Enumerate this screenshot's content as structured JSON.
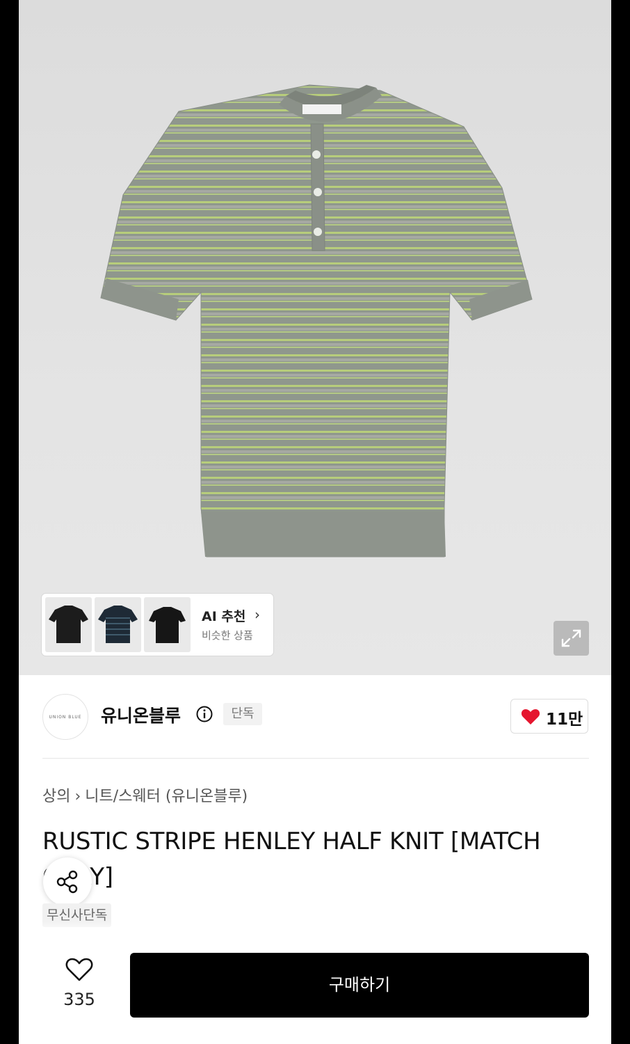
{
  "ai_recommend": {
    "title": "AI 추천",
    "subtitle": "비슷한 상품",
    "thumbnails": [
      "black-knit-tee",
      "navy-stripe-knit-tee",
      "black-knit-tee-2"
    ]
  },
  "brand": {
    "logo_text": "UNION BLUE",
    "name": "유니온블루",
    "badge": "단독",
    "likes": "11만"
  },
  "breadcrumb": {
    "category": "상의",
    "subcategory": "니트/스웨터 (유니온블루)"
  },
  "product": {
    "title": "RUSTIC STRIPE HENLEY HALF KNIT [MATCH GRAY]",
    "exclusive_tag": "무신사단독"
  },
  "bottom_bar": {
    "wish_count": "335",
    "buy_label": "구매하기"
  },
  "colors": {
    "accent_heart": "#e5162f",
    "buy_button": "#000000",
    "shirt_gray": "#8e968c",
    "stripe_green": "#b9d07a"
  }
}
